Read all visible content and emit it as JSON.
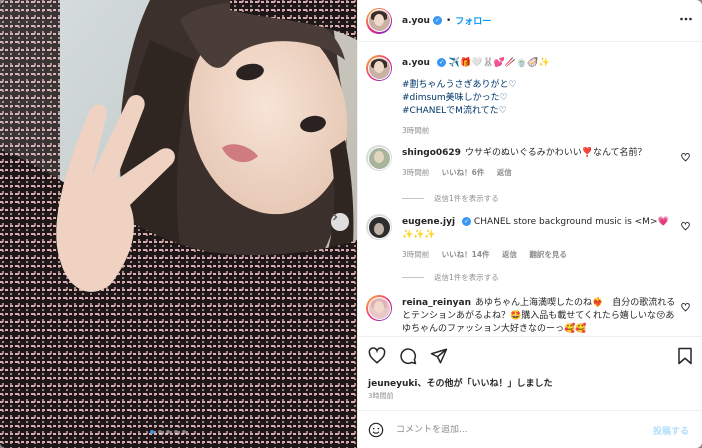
{
  "colors": {
    "accent": "#0095f6",
    "link": "#00376b",
    "muted": "#8e8e8e",
    "verified": "#3897f0",
    "post_disabled": "#b2dffc"
  },
  "header": {
    "username": "a.you",
    "separator": "•",
    "follow_label": "フォロー",
    "more_icon": "more-icon"
  },
  "caption": {
    "username": "a.you",
    "emoji_line": "✈️🎁🤍🐰💕🥢🍵🦪✨",
    "hashtags": [
      "#劃ちゃんうさぎありがと♡",
      "#dimsum美味しかった♡",
      "#CHANELでM流れてた♡"
    ],
    "time": "3時間前"
  },
  "comments": [
    {
      "username": "shingo0629",
      "text": "ウサギのぬいぐるみかわいい❣️なんて名前？",
      "time": "3時間前",
      "likes": "いいね！6件",
      "reply": "返信",
      "translate": "",
      "replies_label": "返信1件を表示する"
    },
    {
      "username": "eugene.jyj",
      "text": "CHANEL store background music is <M>💗✨✨✨",
      "time": "3時間前",
      "likes": "いいね！14件",
      "reply": "返信",
      "translate": "翻訳を見る",
      "replies_label": "返信1件を表示する"
    },
    {
      "username": "reina_reinyan",
      "text": "あゆちゃん上海満喫したのね❤️‍🔥　自分の歌流れるとテンションあがるよね？🤩購入品も載せてくれたら嬉しいな😚あゆちゃんのファッション大好きなのーっ🥰🥰"
    }
  ],
  "actions": {
    "like_icon": "heart-icon",
    "comment_icon": "comment-icon",
    "share_icon": "share-icon",
    "save_icon": "bookmark-icon",
    "liked_by_user": "jeuneyuki",
    "liked_by_rest": "、その他が「いいね！」しました",
    "time": "3時間前"
  },
  "composer": {
    "placeholder": "コメントを追加...",
    "post_label": "投稿する",
    "emoji_icon": "smiley-icon"
  },
  "carousel": {
    "slide_count": 5,
    "active_index": 0
  }
}
